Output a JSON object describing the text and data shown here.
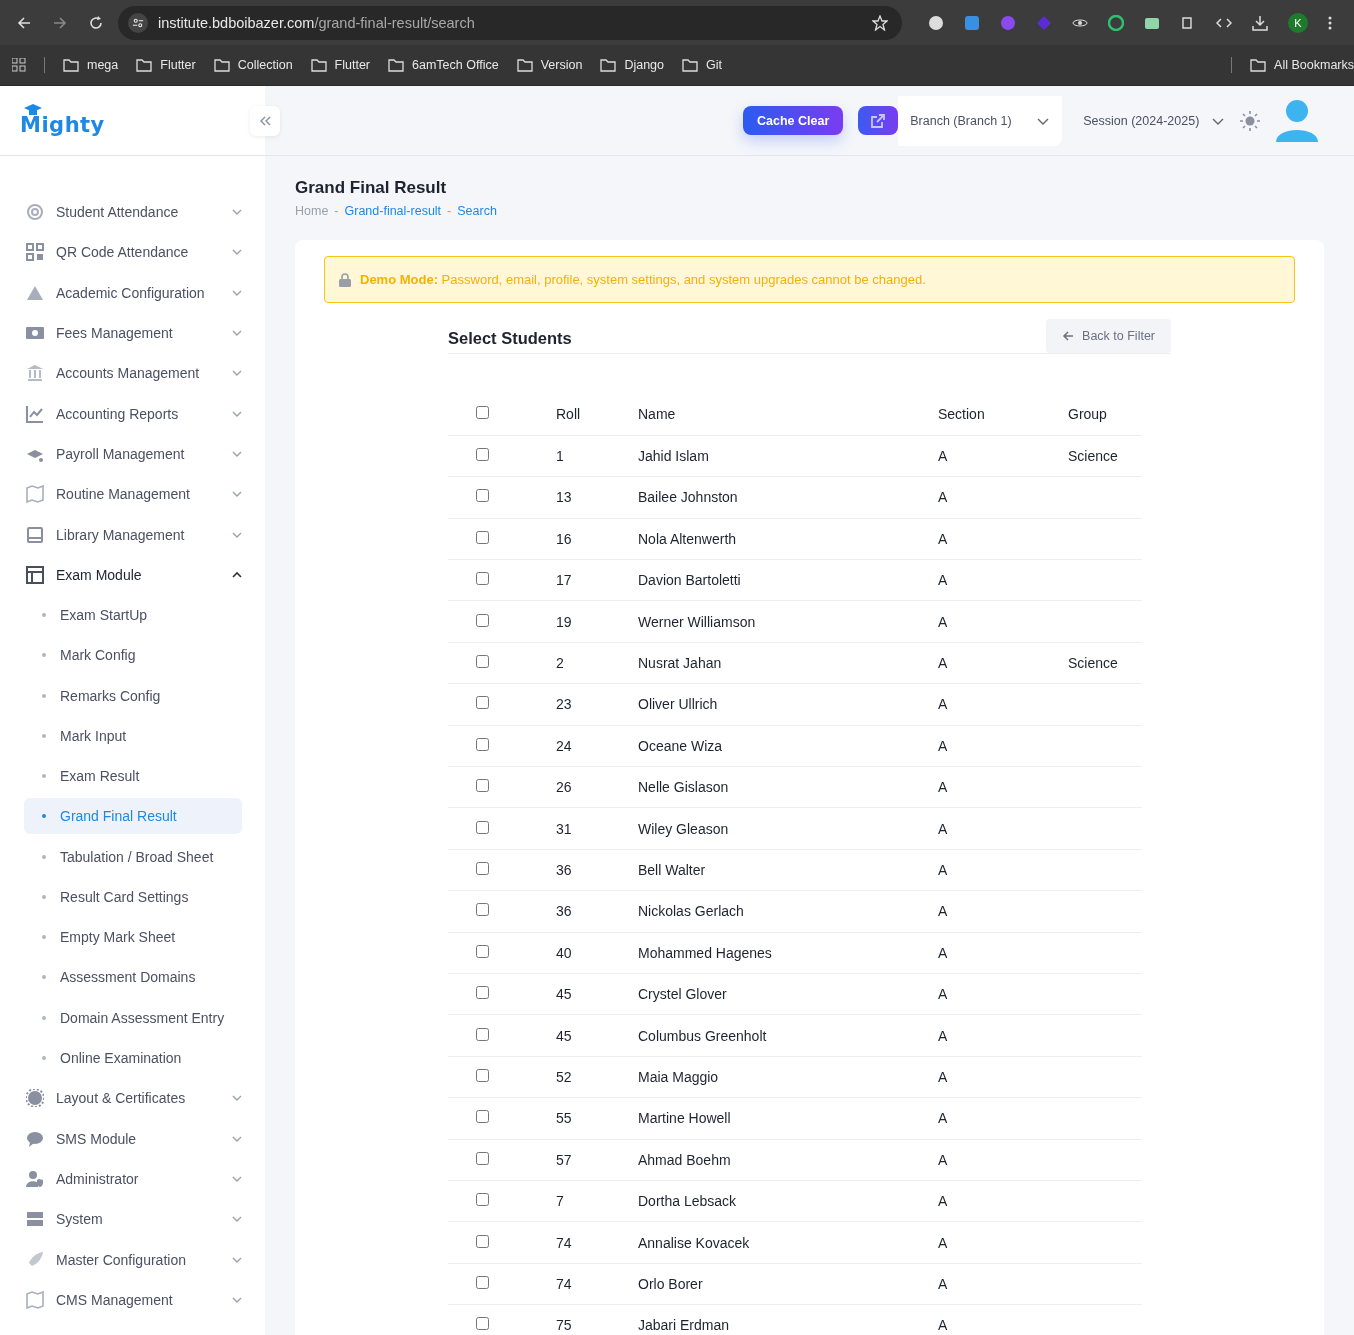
{
  "browser": {
    "url_host": "institute.bdboibazer.com",
    "url_path": "/grand-final-result/search",
    "profile": "K",
    "bookmarks": [
      "mega",
      "Flutter",
      "Collection",
      "Flutter",
      "6amTech Office",
      "Version",
      "Django",
      "Git"
    ],
    "all_bookmarks": "All Bookmarks"
  },
  "logo": "Mighty",
  "header": {
    "cache_button": "Cache Clear",
    "branch": "Branch (Branch 1)",
    "session": "Session (2024-2025)"
  },
  "sidebar": {
    "items": [
      {
        "label": "Student Attendance",
        "expanded": false
      },
      {
        "label": "QR Code Attendance",
        "expanded": false
      },
      {
        "label": "Academic Configuration",
        "expanded": false
      },
      {
        "label": "Fees Management",
        "expanded": false
      },
      {
        "label": "Accounts Management",
        "expanded": false
      },
      {
        "label": "Accounting Reports",
        "expanded": false
      },
      {
        "label": "Payroll Management",
        "expanded": false
      },
      {
        "label": "Routine Management",
        "expanded": false
      },
      {
        "label": "Library Management",
        "expanded": false
      },
      {
        "label": "Exam Module",
        "expanded": true,
        "children": [
          {
            "label": "Exam StartUp",
            "selected": false
          },
          {
            "label": "Mark Config",
            "selected": false
          },
          {
            "label": "Remarks Config",
            "selected": false
          },
          {
            "label": "Mark Input",
            "selected": false
          },
          {
            "label": "Exam Result",
            "selected": false
          },
          {
            "label": "Grand Final Result",
            "selected": true
          },
          {
            "label": "Tabulation / Broad Sheet",
            "selected": false
          },
          {
            "label": "Result Card Settings",
            "selected": false
          },
          {
            "label": "Empty Mark Sheet",
            "selected": false
          },
          {
            "label": "Assessment Domains",
            "selected": false
          },
          {
            "label": "Domain Assessment Entry",
            "selected": false
          },
          {
            "label": "Online Examination",
            "selected": false
          }
        ]
      },
      {
        "label": "Layout & Certificates",
        "expanded": false
      },
      {
        "label": "SMS Module",
        "expanded": false
      },
      {
        "label": "Administrator",
        "expanded": false
      },
      {
        "label": "System",
        "expanded": false
      },
      {
        "label": "Master Configuration",
        "expanded": false
      },
      {
        "label": "CMS Management",
        "expanded": false
      }
    ]
  },
  "page": {
    "title": "Grand Final Result",
    "breadcrumb": [
      "Home",
      "Grand-final-result",
      "Search"
    ],
    "breadcrumb_separator": "-"
  },
  "alert": {
    "label": "Demo Mode:",
    "message": "Password, email, profile, system settings, and system upgrades cannot be changed."
  },
  "panel": {
    "title": "Select Students",
    "back_button": "Back to Filter"
  },
  "table": {
    "all_checked": false,
    "columns": [
      "Roll",
      "Name",
      "Section",
      "Group"
    ],
    "rows": [
      {
        "checked": false,
        "cells": [
          "1",
          "Jahid Islam",
          "A",
          "Science"
        ]
      },
      {
        "checked": false,
        "cells": [
          "13",
          "Bailee Johnston",
          "A",
          ""
        ]
      },
      {
        "checked": false,
        "cells": [
          "16",
          "Nola Altenwerth",
          "A",
          ""
        ]
      },
      {
        "checked": false,
        "cells": [
          "17",
          "Davion Bartoletti",
          "A",
          ""
        ]
      },
      {
        "checked": false,
        "cells": [
          "19",
          "Werner Williamson",
          "A",
          ""
        ]
      },
      {
        "checked": false,
        "cells": [
          "2",
          "Nusrat Jahan",
          "A",
          "Science"
        ]
      },
      {
        "checked": false,
        "cells": [
          "23",
          "Oliver Ullrich",
          "A",
          ""
        ]
      },
      {
        "checked": false,
        "cells": [
          "24",
          "Oceane Wiza",
          "A",
          ""
        ]
      },
      {
        "checked": false,
        "cells": [
          "26",
          "Nelle Gislason",
          "A",
          ""
        ]
      },
      {
        "checked": false,
        "cells": [
          "31",
          "Wiley Gleason",
          "A",
          ""
        ]
      },
      {
        "checked": false,
        "cells": [
          "36",
          "Bell Walter",
          "A",
          ""
        ]
      },
      {
        "checked": false,
        "cells": [
          "36",
          "Nickolas Gerlach",
          "A",
          ""
        ]
      },
      {
        "checked": false,
        "cells": [
          "40",
          "Mohammed Hagenes",
          "A",
          ""
        ]
      },
      {
        "checked": false,
        "cells": [
          "45",
          "Crystel Glover",
          "A",
          ""
        ]
      },
      {
        "checked": false,
        "cells": [
          "45",
          "Columbus Greenholt",
          "A",
          ""
        ]
      },
      {
        "checked": false,
        "cells": [
          "52",
          "Maia Maggio",
          "A",
          ""
        ]
      },
      {
        "checked": false,
        "cells": [
          "55",
          "Martine Howell",
          "A",
          ""
        ]
      },
      {
        "checked": false,
        "cells": [
          "57",
          "Ahmad Boehm",
          "A",
          ""
        ]
      },
      {
        "checked": false,
        "cells": [
          "7",
          "Dortha Lebsack",
          "A",
          ""
        ]
      },
      {
        "checked": false,
        "cells": [
          "74",
          "Annalise Kovacek",
          "A",
          ""
        ]
      },
      {
        "checked": false,
        "cells": [
          "74",
          "Orlo Borer",
          "A",
          ""
        ]
      },
      {
        "checked": false,
        "cells": [
          "75",
          "Jabari Erdman",
          "A",
          ""
        ]
      }
    ]
  }
}
